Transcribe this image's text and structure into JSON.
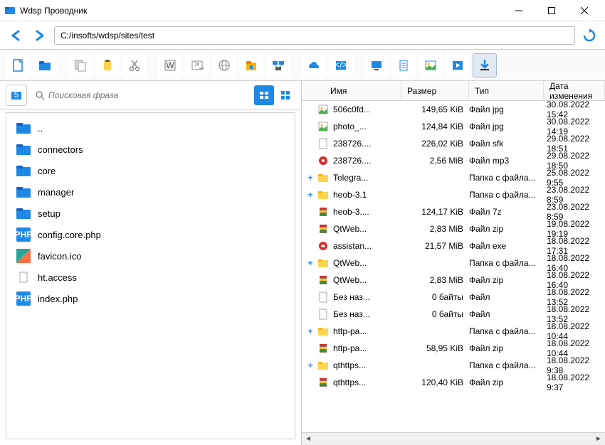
{
  "window": {
    "title": "Wdsp Проводник"
  },
  "address": {
    "path": "C:/insofts/wdsp/sites/test"
  },
  "search": {
    "placeholder": "Поисковая фраза"
  },
  "columns": {
    "name": "Имя",
    "size": "Размер",
    "type": "Тип",
    "date": "Дата изменения"
  },
  "tree": [
    {
      "icon": "folder-blue",
      "label": ".."
    },
    {
      "icon": "folder-blue",
      "label": "connectors"
    },
    {
      "icon": "folder-blue",
      "label": "core"
    },
    {
      "icon": "folder-blue",
      "label": "manager"
    },
    {
      "icon": "folder-blue",
      "label": "setup"
    },
    {
      "icon": "php",
      "label": "config.core.php"
    },
    {
      "icon": "favicon",
      "label": "favicon.ico"
    },
    {
      "icon": "file",
      "label": "ht.access"
    },
    {
      "icon": "php",
      "label": "index.php"
    }
  ],
  "files": [
    {
      "exp": "",
      "icon": "img",
      "name": "506c0fd...",
      "size": "149,65 KiB",
      "type": "Файл jpg",
      "date": "30.08.2022 15:42"
    },
    {
      "exp": "",
      "icon": "img",
      "name": "photo_...",
      "size": "124,84 KiB",
      "type": "Файл jpg",
      "date": "30.08.2022 14:19"
    },
    {
      "exp": "",
      "icon": "file",
      "name": "238726....",
      "size": "226,02 KiB",
      "type": "Файл sfk",
      "date": "29.08.2022 18:51"
    },
    {
      "exp": "",
      "icon": "audio",
      "name": "238726....",
      "size": "2,56 MiB",
      "type": "Файл mp3",
      "date": "29.08.2022 18:50"
    },
    {
      "exp": "+",
      "icon": "folder",
      "name": "Telegra...",
      "size": "",
      "type": "Папка с файла...",
      "date": "25.08.2022 9:55"
    },
    {
      "exp": "+",
      "icon": "folder",
      "name": "heob-3.1",
      "size": "",
      "type": "Папка с файла...",
      "date": "23.08.2022 8:59"
    },
    {
      "exp": "",
      "icon": "archive",
      "name": "heob-3....",
      "size": "124,17 KiB",
      "type": "Файл 7z",
      "date": "23.08.2022 8:59"
    },
    {
      "exp": "",
      "icon": "archive",
      "name": "QtWeb...",
      "size": "2,83 MiB",
      "type": "Файл zip",
      "date": "19.08.2022 19:19"
    },
    {
      "exp": "",
      "icon": "exe",
      "name": "assistan...",
      "size": "21,57 MiB",
      "type": "Файл exe",
      "date": "18.08.2022 17:31"
    },
    {
      "exp": "+",
      "icon": "folder",
      "name": "QtWeb...",
      "size": "",
      "type": "Папка с файла...",
      "date": "18.08.2022 16:40"
    },
    {
      "exp": "",
      "icon": "archive",
      "name": "QtWeb...",
      "size": "2,83 MiB",
      "type": "Файл zip",
      "date": "18.08.2022 16:40"
    },
    {
      "exp": "",
      "icon": "file",
      "name": "Без наз...",
      "size": "0 байты",
      "type": "Файл",
      "date": "18.08.2022 13:52"
    },
    {
      "exp": "",
      "icon": "file",
      "name": "Без наз...",
      "size": "0 байты",
      "type": "Файл",
      "date": "18.08.2022 13:52"
    },
    {
      "exp": "+",
      "icon": "folder",
      "name": "http-pa...",
      "size": "",
      "type": "Папка с файла...",
      "date": "18.08.2022 10:44"
    },
    {
      "exp": "",
      "icon": "archive",
      "name": "http-pa...",
      "size": "58,95 KiB",
      "type": "Файл zip",
      "date": "18.08.2022 10:44"
    },
    {
      "exp": "+",
      "icon": "folder",
      "name": "qthttps...",
      "size": "",
      "type": "Папка с файла...",
      "date": "18.08.2022 9:38"
    },
    {
      "exp": "",
      "icon": "archive",
      "name": "qthttps...",
      "size": "120,40 KiB",
      "type": "Файл zip",
      "date": "18.08.2022 9:37"
    }
  ]
}
